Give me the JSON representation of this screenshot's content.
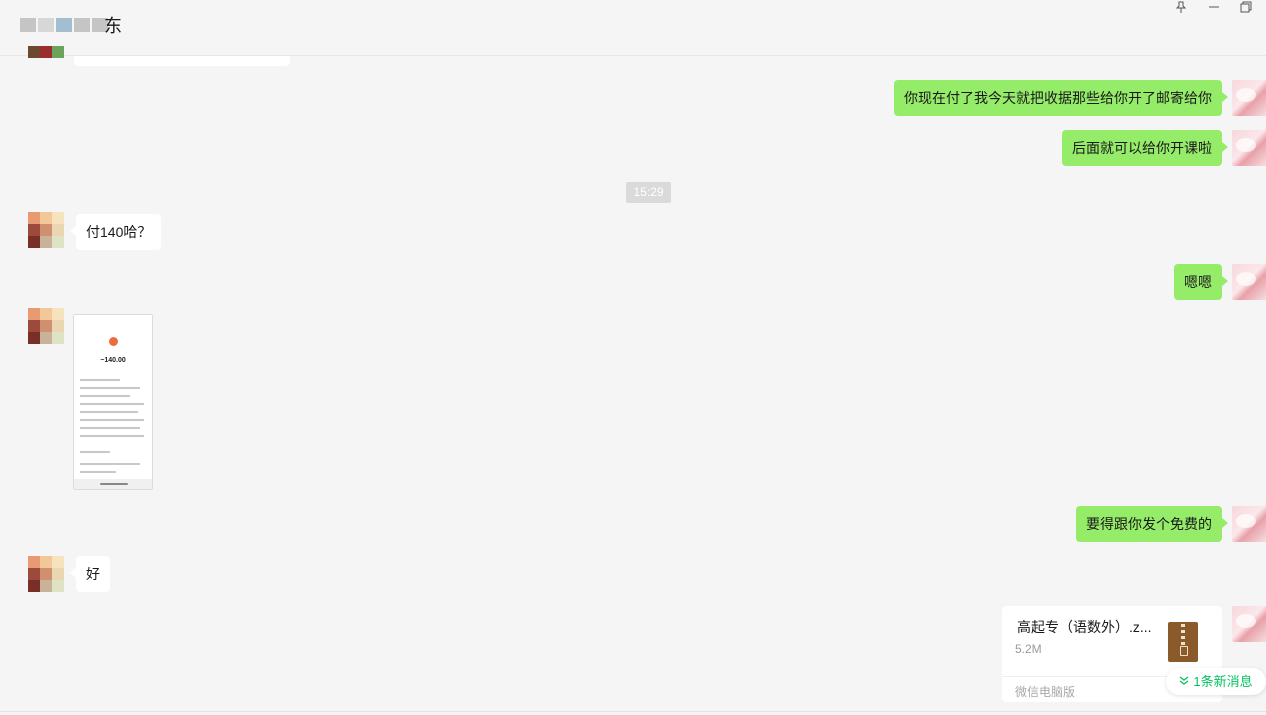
{
  "title": {
    "name_visible_char": "东"
  },
  "window_controls": {
    "pin_icon": "pin-icon",
    "minimize_icon": "minimize-icon",
    "restore_icon": "restore-icon"
  },
  "colors": {
    "accent_green": "#95ec69",
    "new_msg_green": "#07c160",
    "background": "#f5f5f5"
  },
  "messages": [
    {
      "side": "right",
      "text": "你现在付了我今天就把收据那些给你开了邮寄给你"
    },
    {
      "side": "right",
      "text": "后面就可以给你开课啦"
    },
    {
      "type": "time",
      "text": "15:29"
    },
    {
      "side": "left",
      "text": "付140哈？"
    },
    {
      "side": "right",
      "text": "嗯嗯"
    },
    {
      "side": "left",
      "type": "image",
      "amount": "−140.00"
    },
    {
      "side": "right",
      "text": "要得跟你发个免费的"
    },
    {
      "side": "left",
      "text": "好"
    },
    {
      "side": "right",
      "type": "file",
      "name": "高起专（语数外）.z...",
      "size": "5.2M",
      "source": "微信电脑版"
    }
  ],
  "new_messages": {
    "label": "1条新消息"
  }
}
